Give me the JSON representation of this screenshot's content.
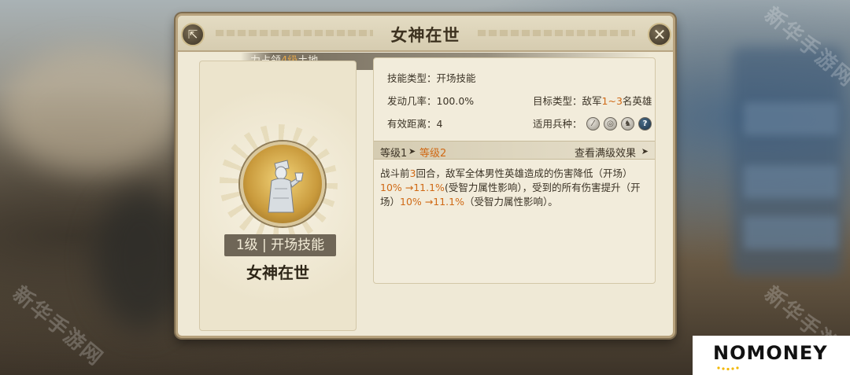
{
  "watermark": "新华手游网",
  "dialog": {
    "title": "女神在世",
    "hint": {
      "prefix": "力占领",
      "highlight": "4级",
      "suffix": "土地。"
    }
  },
  "skill_card": {
    "level_badge": "1级 | 开场技能",
    "name": "女神在世"
  },
  "info": {
    "skill_type": "技能类型：开场技能",
    "trigger_rate": "发动几率：100.0%",
    "target_label": "目标类型：敌军",
    "target_range": "1~3",
    "target_suffix": "名英雄",
    "effective_distance": "有效距离：4",
    "troop_label": "适用兵种：",
    "troops": [
      "infantry-icon",
      "archer-icon",
      "cavalry-icon",
      "unknown-icon"
    ]
  },
  "levels": {
    "current": "等级1",
    "next": "等级2",
    "view_max": "查看满级效果"
  },
  "description": {
    "p1": "战斗前",
    "rounds": "3",
    "p2": "回合，敌军全体男性英雄造成的伤害降低（开场）",
    "v1": "10% →11.1%",
    "p3": "(受智力属性影响），受到的所有伤害提升（开场）",
    "v2": "10% →11.1%",
    "p4": "（受智力属性影响）。"
  },
  "logo": "NOMONEY",
  "colors": {
    "accent": "#d06a16",
    "panel": "#efe9d6",
    "border": "#b7a27d"
  }
}
